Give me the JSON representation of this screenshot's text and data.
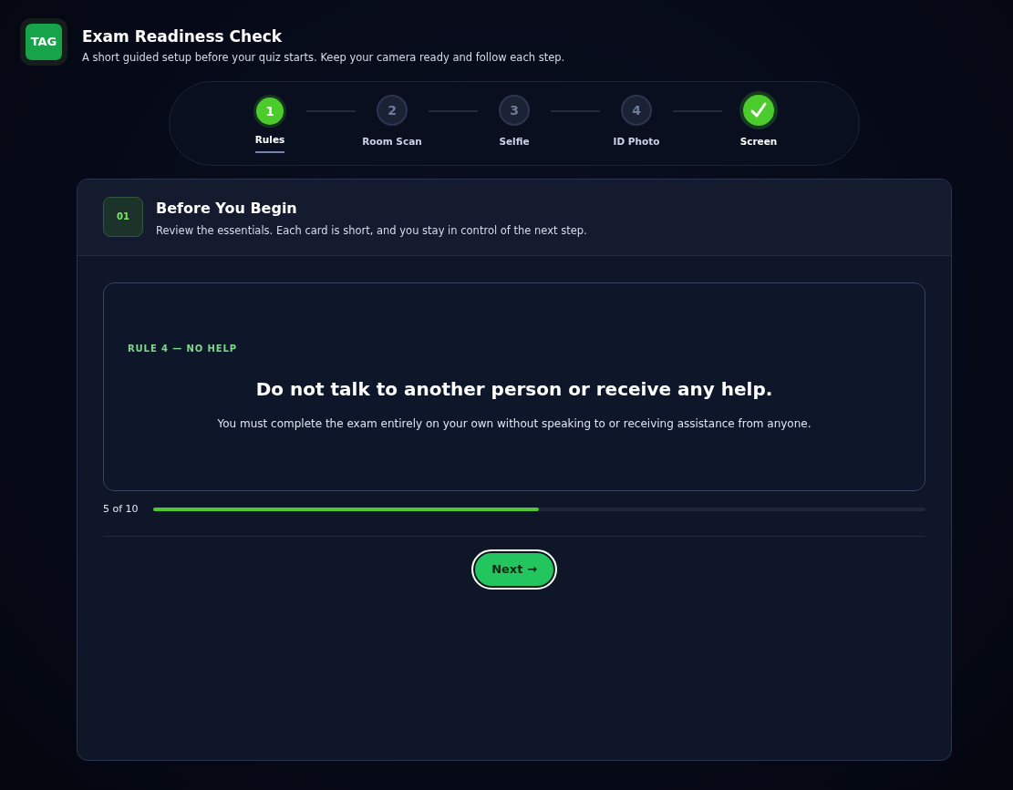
{
  "header": {
    "logo": "TAG",
    "title": "Exam Readiness Check",
    "subtitle": "A short guided setup before your quiz starts. Keep your camera ready and follow each step."
  },
  "steps": [
    {
      "number": "1",
      "label": "Rules",
      "selected": true,
      "done": false
    },
    {
      "number": "2",
      "label": "Room Scan",
      "selected": false,
      "done": false
    },
    {
      "number": "3",
      "label": "Selfie",
      "selected": false,
      "done": false
    },
    {
      "number": "4",
      "label": "ID Photo",
      "selected": false,
      "done": false
    },
    {
      "label": "Screen",
      "selected": false,
      "done": true
    }
  ],
  "panel": {
    "badge": "01",
    "title": "Before You Begin",
    "subtitle": "Review the essentials. Each card is short, and you stay in control of the next step."
  },
  "rule_card": {
    "eyebrow": "RULE 4 — NO HELP",
    "heading": "Do not talk to another person or receive any help.",
    "body": "You must complete the exam entirely on your own without speaking to or receiving assistance from anyone."
  },
  "progress": {
    "reading": "5 of 10",
    "level": 0.5
  },
  "next_button": {
    "label": "Next →"
  }
}
